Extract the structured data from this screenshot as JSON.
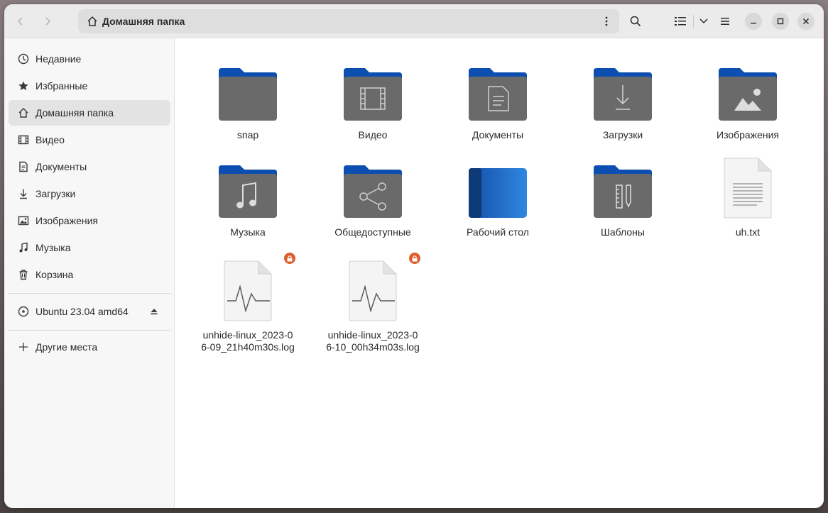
{
  "window": {
    "path_label": "Домашняя папка",
    "colors": {
      "accent": "#1c5fbf",
      "folder_body": "#6a6a6a",
      "folder_tab": "#0d4fb0",
      "lock": "#e05c2a"
    }
  },
  "headerbar": {
    "back_icon": "chevron-left-icon",
    "forward_icon": "chevron-right-icon",
    "home_icon": "home-icon",
    "menu_icon": "vertical-dots-icon",
    "search_icon": "search-icon",
    "view_icon": "list-view-icon",
    "view_dropdown_icon": "chevron-down-icon",
    "main_menu_icon": "hamburger-icon",
    "minimize_icon": "minimize-icon",
    "maximize_icon": "maximize-icon",
    "close_icon": "close-icon"
  },
  "sidebar": {
    "items": [
      {
        "label": "Недавние",
        "icon": "clock-icon"
      },
      {
        "label": "Избранные",
        "icon": "star-icon"
      },
      {
        "label": "Домашняя папка",
        "icon": "home-icon",
        "active": true
      },
      {
        "label": "Видео",
        "icon": "film-icon"
      },
      {
        "label": "Документы",
        "icon": "document-icon"
      },
      {
        "label": "Загрузки",
        "icon": "download-icon"
      },
      {
        "label": "Изображения",
        "icon": "image-icon"
      },
      {
        "label": "Музыка",
        "icon": "music-icon"
      },
      {
        "label": "Корзина",
        "icon": "trash-icon"
      }
    ],
    "drive": {
      "label": "Ubuntu 23.04 amd64",
      "icon": "disc-icon",
      "eject_icon": "eject-icon"
    },
    "other": {
      "label": "Другие места",
      "icon": "plus-icon"
    }
  },
  "files": [
    {
      "name": "snap",
      "type": "folder",
      "emblem": "none"
    },
    {
      "name": "Видео",
      "type": "folder",
      "emblem": "film"
    },
    {
      "name": "Документы",
      "type": "folder",
      "emblem": "document"
    },
    {
      "name": "Загрузки",
      "type": "folder",
      "emblem": "download"
    },
    {
      "name": "Изображения",
      "type": "folder",
      "emblem": "image"
    },
    {
      "name": "Музыка",
      "type": "folder",
      "emblem": "music"
    },
    {
      "name": "Общедоступные",
      "type": "folder",
      "emblem": "share"
    },
    {
      "name": "Рабочий стол",
      "type": "desktop-folder",
      "emblem": "none"
    },
    {
      "name": "Шаблоны",
      "type": "folder",
      "emblem": "template"
    },
    {
      "name": "uh.txt",
      "type": "text-file",
      "emblem": "none"
    },
    {
      "name": "unhide-linux_2023-06-09_21h40m30s.log",
      "type": "log-file",
      "locked": true
    },
    {
      "name": "unhide-linux_2023-06-10_00h34m03s.log",
      "type": "log-file",
      "locked": true
    }
  ]
}
